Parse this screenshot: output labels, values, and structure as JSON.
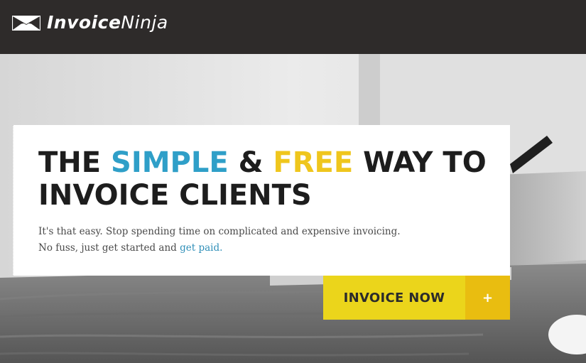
{
  "header": {
    "brand_bold": "Invoice",
    "brand_light": "Ninja",
    "icon": "ninja-mask-icon"
  },
  "hero": {
    "headline": {
      "word1": "THE ",
      "word_simple": "SIMPLE",
      "amp": " & ",
      "word_free": "FREE",
      "rest": " WAY TO INVOICE CLIENTS"
    },
    "tagline_line1": "It's that easy. Stop spending time on complicated and expensive invoicing.",
    "tagline_line2_prefix": "No fuss, just get started and ",
    "tagline_link": "get paid.",
    "cta_label": "INVOICE NOW",
    "cta_plus": "+"
  },
  "colors": {
    "header_bg": "#2e2b2a",
    "accent_blue": "#2f9fc8",
    "accent_yellow": "#efc61d",
    "cta_yellow": "#ebd51b",
    "cta_plus_yellow": "#e9bd10"
  }
}
